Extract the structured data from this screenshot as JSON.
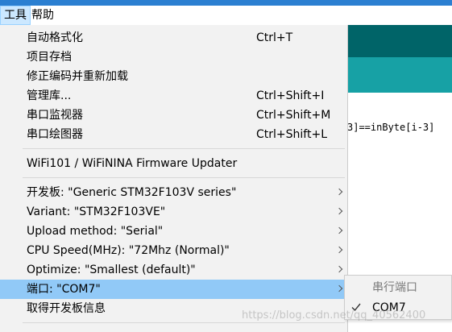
{
  "menubar": {
    "items": [
      {
        "label": "工具",
        "active": true
      },
      {
        "label": "帮助",
        "active": false
      }
    ]
  },
  "editor": {
    "code_line": "3]==inByte[i-3]"
  },
  "tools_menu": {
    "items": [
      {
        "label": "自动格式化",
        "shortcut": "Ctrl+T"
      },
      {
        "label": "项目存档",
        "shortcut": ""
      },
      {
        "label": "修正编码并重新加载",
        "shortcut": ""
      },
      {
        "label": "管理库...",
        "shortcut": "Ctrl+Shift+I"
      },
      {
        "label": "串口监视器",
        "shortcut": "Ctrl+Shift+M"
      },
      {
        "label": "串口绘图器",
        "shortcut": "Ctrl+Shift+L"
      },
      {
        "label": "WiFi101 / WiFiNINA Firmware Updater",
        "shortcut": ""
      },
      {
        "label": "开发板: \"Generic STM32F103V series\"",
        "submenu": true
      },
      {
        "label": "Variant: \"STM32F103VE\"",
        "submenu": true
      },
      {
        "label": "Upload method: \"Serial\"",
        "submenu": true
      },
      {
        "label": "CPU Speed(MHz): \"72Mhz (Normal)\"",
        "submenu": true
      },
      {
        "label": "Optimize: \"Smallest (default)\"",
        "submenu": true
      },
      {
        "label": "端口: \"COM7\"",
        "submenu": true,
        "highlighted": true
      },
      {
        "label": "取得开发板信息",
        "shortcut": ""
      }
    ]
  },
  "port_submenu": {
    "header": "串行端口",
    "items": [
      {
        "label": "COM7",
        "checked": true
      }
    ]
  },
  "watermark": "https://blog.csdn.net/qq_40562400",
  "colors": {
    "highlight": "#91c9f7",
    "menu_bg": "#f2f2f2",
    "ide_header": "#006468",
    "ide_toolbar": "#17a1a5"
  }
}
